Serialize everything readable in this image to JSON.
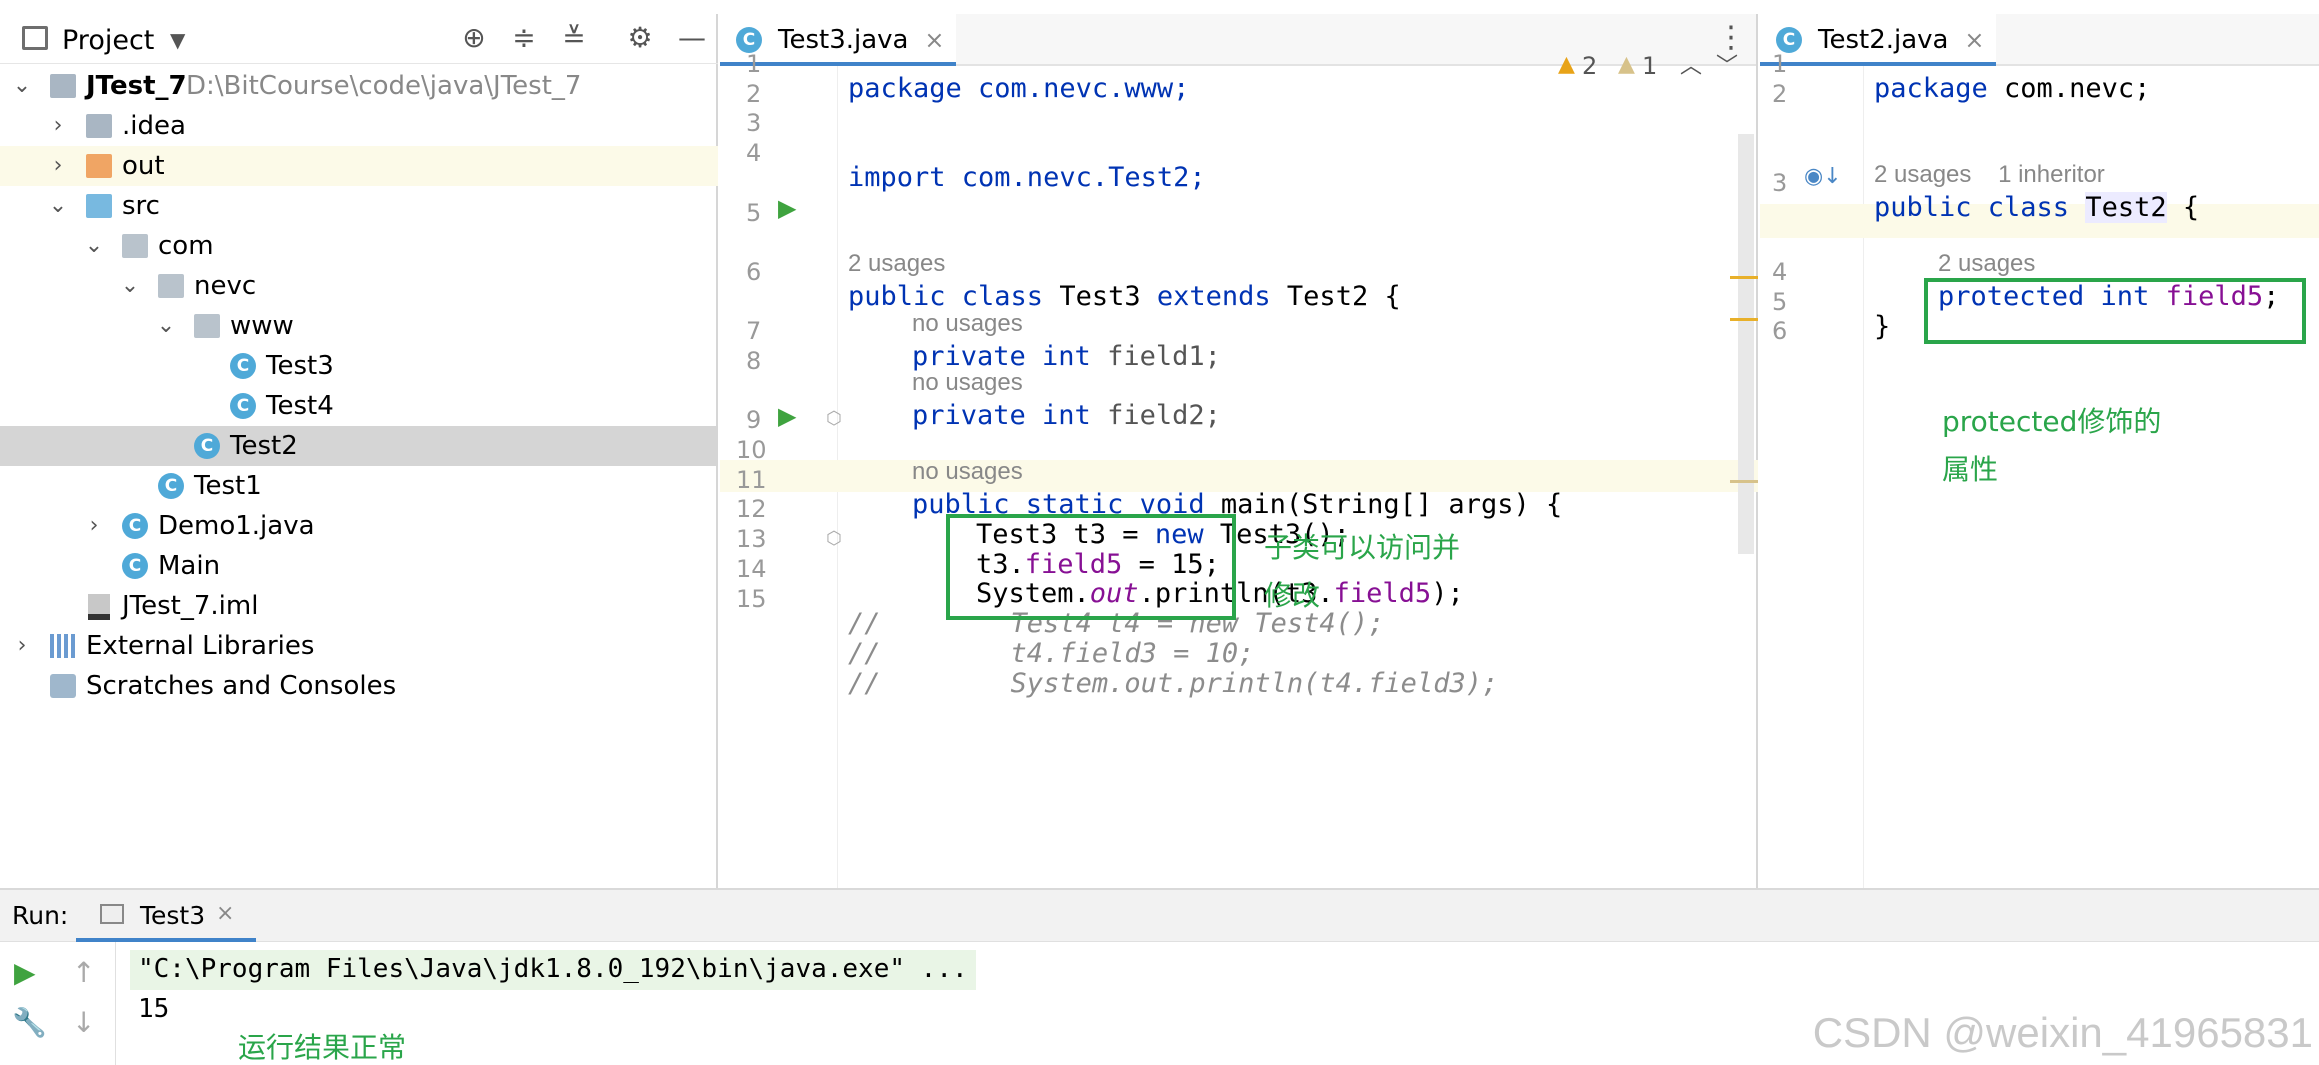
{
  "project_panel": {
    "title": "Project",
    "tree": [
      {
        "label": "JTest_7",
        "path": "D:\\BitCourse\\code\\java\\JTest_7"
      },
      {
        "label": ".idea"
      },
      {
        "label": "out"
      },
      {
        "label": "src"
      },
      {
        "label": "com"
      },
      {
        "label": "nevc"
      },
      {
        "label": "www"
      },
      {
        "label": "Test3"
      },
      {
        "label": "Test4"
      },
      {
        "label": "Test2"
      },
      {
        "label": "Test1"
      },
      {
        "label": "Demo1.java"
      },
      {
        "label": "Main"
      },
      {
        "label": "JTest_7.iml"
      },
      {
        "label": "External Libraries"
      },
      {
        "label": "Scratches and Consoles"
      }
    ]
  },
  "editor_left": {
    "tab": "Test3.java",
    "warnings": {
      "warn": "2",
      "weak": "1"
    },
    "hints": {
      "usages2": "2 usages",
      "no_usages": "no usages"
    },
    "lines": {
      "l1": "package com.nevc.www;",
      "l3": "import com.nevc.Test2;",
      "l5a": "public class ",
      "l5b": "Test3 ",
      "l5c": "extends ",
      "l5d": "Test2 {",
      "l6a": "private int ",
      "l6b": "field1;",
      "l7a": "private int ",
      "l7b": "field2;",
      "l9a": "public static void ",
      "l9b": "main(String[] args) {",
      "l10a": "Test3 t3 = ",
      "l10b": "new ",
      "l10c": "Test3();",
      "l11a": "t3.",
      "l11b": "field5",
      "l11c": " = 15;",
      "l12a": "System.",
      "l12b": "out",
      "l12c": ".println(t3.",
      "l12d": "field5",
      "l12e": ");",
      "l13": "//        Test4 t4 = new Test4();",
      "l14": "//        t4.field3 = 10;",
      "l15": "//        System.out.println(t4.field3);"
    },
    "annotation": [
      "子类可以访问并",
      "修改"
    ]
  },
  "editor_right": {
    "tab": "Test2.java",
    "hints": {
      "usages_inheritor": "2 usages    1 inheritor",
      "usages2": "2 usages"
    },
    "lines": {
      "l1a": "package ",
      "l1b": "com.nevc;",
      "l3a": "public class ",
      "l3b": "Test2",
      "l3c": " {",
      "l4a": "protected int ",
      "l4b": "field5",
      "l4c": ";",
      "l5": "}"
    },
    "annotation": [
      "protected修饰的",
      "属性"
    ]
  },
  "run_panel": {
    "label": "Run:",
    "tab": "Test3",
    "cmd": "\"C:\\Program Files\\Java\\jdk1.8.0_192\\bin\\java.exe\" ...",
    "output": "15",
    "annotation": "运行结果正常"
  },
  "line_numbers_left": [
    "1",
    "2",
    "3",
    "4",
    "5",
    "6",
    "7",
    "8",
    "9",
    "10",
    "11",
    "12",
    "13",
    "14",
    "15"
  ],
  "line_numbers_right": [
    "1",
    "2",
    "3",
    "4",
    "5",
    "6"
  ],
  "watermark": "CSDN @weixin_41965831",
  "colors": {
    "keyword": "#0033b3",
    "field": "#871094",
    "annotation": "#2aa54a",
    "accent": "#4083c9"
  }
}
